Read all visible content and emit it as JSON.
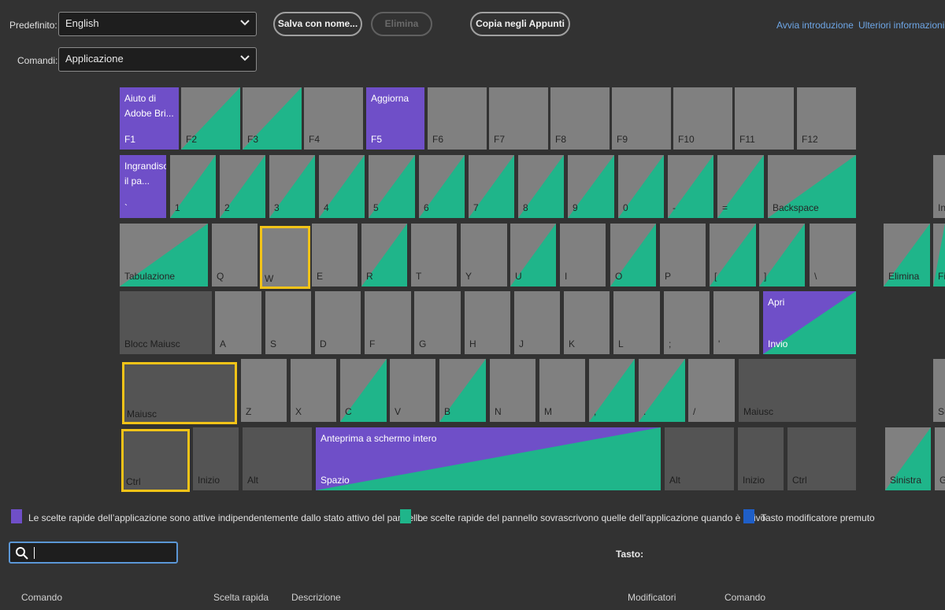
{
  "header": {
    "preset_label": "Predefinito:",
    "preset_value": "English",
    "commands_label": "Comandi:",
    "commands_value": "Applicazione",
    "save_as": "Salva con nome...",
    "delete": "Elimina",
    "copy_clipboard": "Copia negli Appunti",
    "start_intro": "Avvia introduzione",
    "more_info": "Ulteriori informazioni"
  },
  "keys": {
    "f1": "F1",
    "f1_cmd": "Aiuto di Adobe Bri...",
    "f2": "F2",
    "f3": "F3",
    "f4": "F4",
    "f5": "F5",
    "f5_cmd": "Aggiorna",
    "f6": "F6",
    "f7": "F7",
    "f8": "F8",
    "f9": "F9",
    "f10": "F10",
    "f11": "F11",
    "f12": "F12",
    "backtick": "`",
    "backtick_cmd": "Ingrandisci il pa...",
    "n1": "1",
    "n2": "2",
    "n3": "3",
    "n4": "4",
    "n5": "5",
    "n6": "6",
    "n7": "7",
    "n8": "8",
    "n9": "9",
    "n0": "0",
    "minus": "-",
    "equals": "=",
    "backspace": "Backspace",
    "ins": "In",
    "tab": "Tabulazione",
    "q": "Q",
    "w": "W",
    "e": "E",
    "r": "R",
    "t": "T",
    "y": "Y",
    "u": "U",
    "i": "I",
    "o": "O",
    "p": "P",
    "lbracket": "[",
    "rbracket": "]",
    "backslash": "\\",
    "del": "Elimina",
    "fine": "Fi",
    "caps": "Blocc Maiusc",
    "a": "A",
    "s": "S",
    "d": "D",
    "f": "F",
    "g": "G",
    "h": "H",
    "j": "J",
    "k": "K",
    "l": "L",
    "semicolon": ";",
    "quote": "'",
    "enter": "Invio",
    "enter_cmd": "Apri",
    "lshift": "Maiusc",
    "z": "Z",
    "x": "X",
    "c": "C",
    "v": "V",
    "b": "B",
    "n": "N",
    "m": "M",
    "comma": ",",
    "period": ".",
    "slash": "/",
    "rshift": "Maiusc",
    "su": "Su",
    "lctrl": "Ctrl",
    "lstart": "Inizio",
    "lalt": "Alt",
    "space": "Spazio",
    "space_cmd": "Anteprima a schermo intero",
    "ralt": "Alt",
    "rstart": "Inizio",
    "rctrl": "Ctrl",
    "left": "Sinistra",
    "giu": "G"
  },
  "legend": {
    "app": "Le scelte rapide dell’applicazione sono attive indipendentemente dallo stato attivo del pannello",
    "panel": "Le scelte rapide del pannello sovrascrivono quelle dell’applicazione quando è attivo",
    "modifier": "Tasto modificatore premuto"
  },
  "colors": {
    "purple": "#6f4fc8",
    "green": "#1fb58a",
    "blue": "#1f5fc8",
    "selected": "#f2c318"
  },
  "table": {
    "key_label": "Tasto:",
    "headers": [
      "Comando",
      "Scelta rapida",
      "Descrizione",
      "Modificatori",
      "Comando"
    ]
  }
}
